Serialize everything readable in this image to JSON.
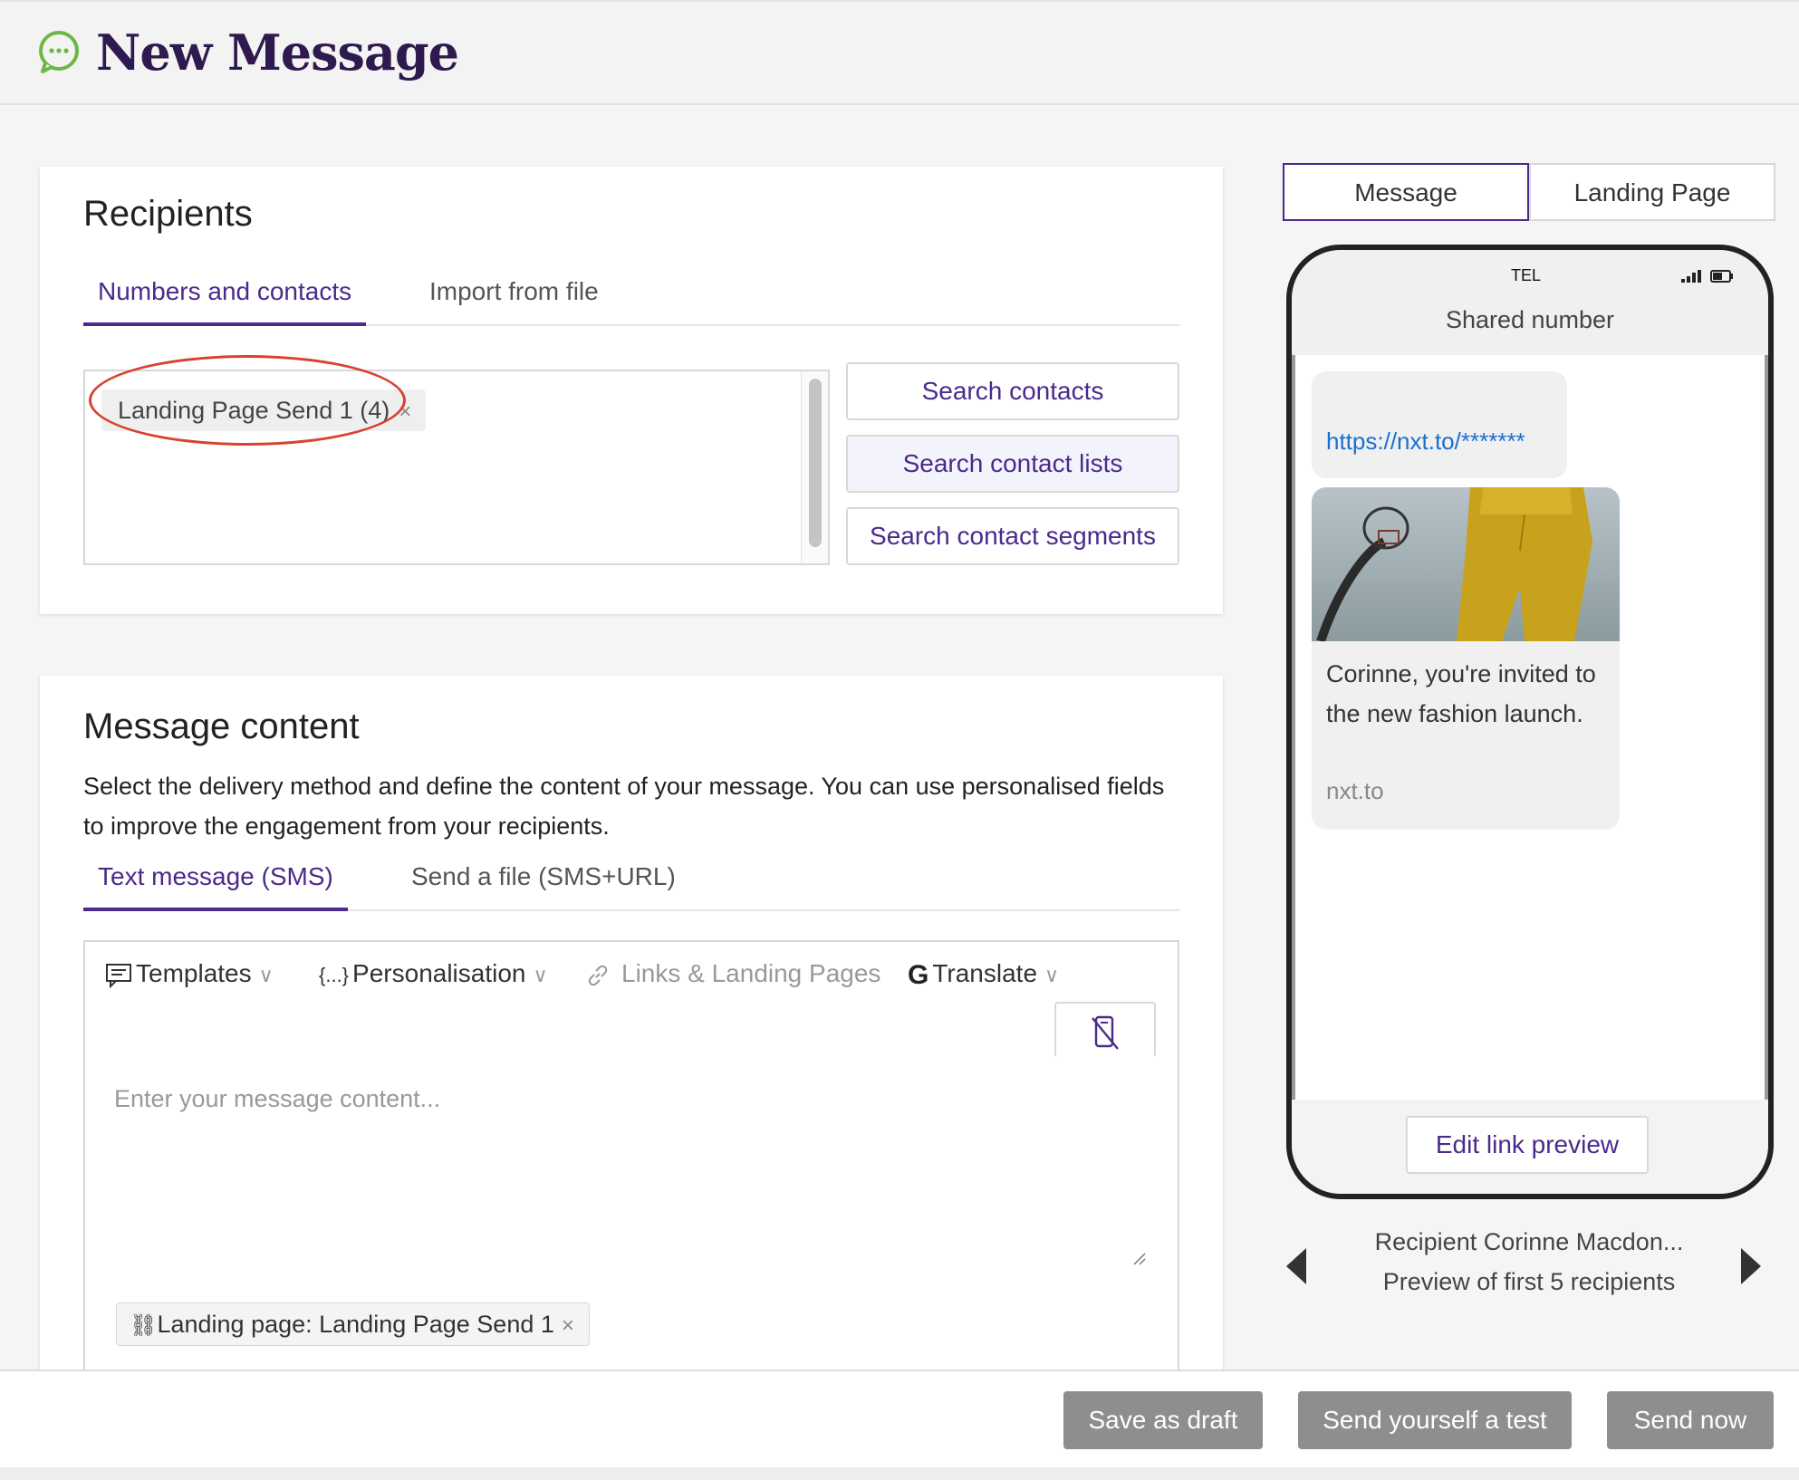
{
  "header": {
    "title": "New Message",
    "icon": "chat-bubble-icon"
  },
  "recipients": {
    "heading": "Recipients",
    "tabs": [
      {
        "label": "Numbers and contacts",
        "active": true
      },
      {
        "label": "Import from file",
        "active": false
      }
    ],
    "chips": [
      {
        "label": "Landing Page Send 1 (4)",
        "remove": "×"
      }
    ],
    "search_buttons": [
      {
        "label": "Search contacts"
      },
      {
        "label": "Search contact lists"
      },
      {
        "label": "Search contact segments"
      }
    ]
  },
  "content": {
    "heading": "Message content",
    "description": "Select the delivery method and define the content of your message. You can use personalised fields to improve the engagement from your recipients.",
    "tabs": [
      {
        "label": "Text message (SMS)",
        "active": true
      },
      {
        "label": "Send a file (SMS+URL)",
        "active": false
      }
    ],
    "toolbar": {
      "templates": "Templates",
      "personalisation": "Personalisation",
      "links": "Links & Landing Pages",
      "translate": "Translate"
    },
    "message": {
      "placeholder": "Enter your message content...",
      "value": ""
    },
    "attachment_chip": {
      "label": "Landing page: Landing Page Send 1",
      "remove": "×"
    }
  },
  "preview": {
    "tabs": [
      {
        "label": "Message",
        "active": true
      },
      {
        "label": "Landing Page",
        "active": false
      }
    ],
    "phone": {
      "carrier": "TEL",
      "sender": "Shared number",
      "link": "https://nxt.to/*******",
      "card_text": "Corinne, you're invited to the new fashion launch.",
      "card_domain": "nxt.to",
      "edit_button": "Edit link preview"
    },
    "recipient_name": "Recipient Corinne Macdon...",
    "recipient_subtitle": "Preview of first 5 recipients"
  },
  "footer": {
    "save_draft": "Save as draft",
    "send_test": "Send yourself a test",
    "send_now": "Send now"
  },
  "colors": {
    "brand_purple": "#4b2a8c",
    "title_purple": "#2e1a4f",
    "icon_green": "#6bb845",
    "highlight_red": "#d9412e",
    "link_blue": "#1a6fd0",
    "disabled_button": "#8e8e8e"
  }
}
